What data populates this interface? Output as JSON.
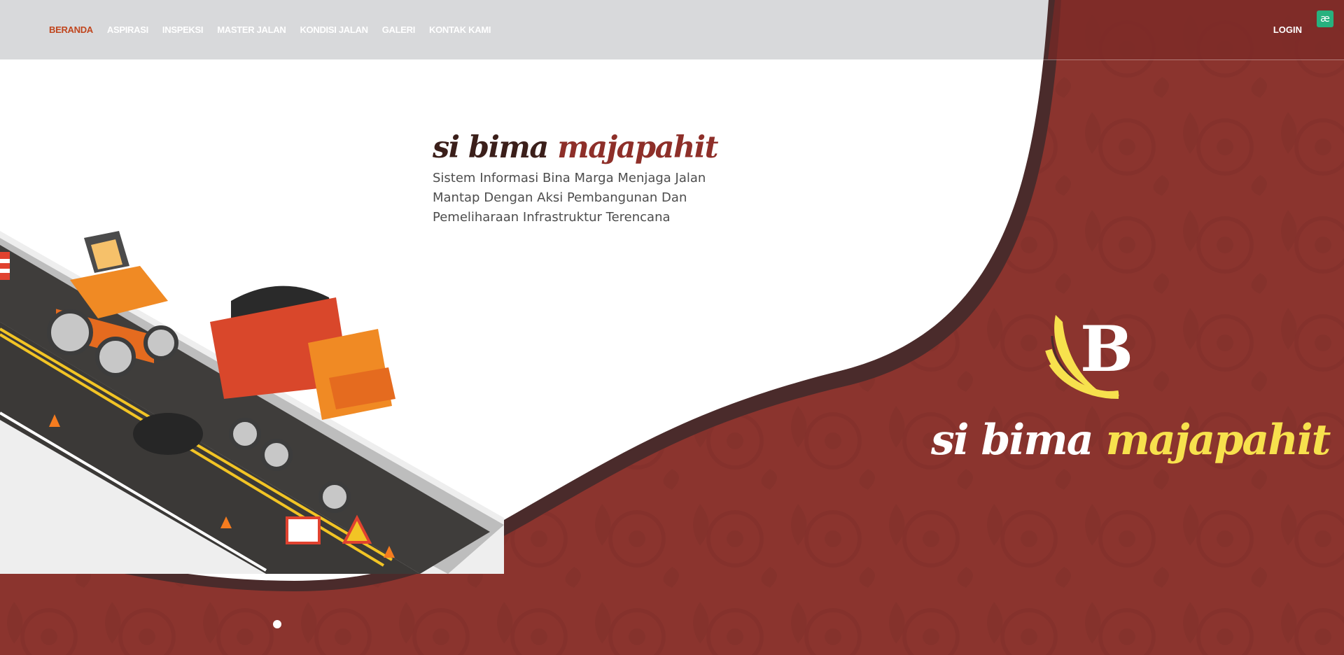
{
  "navbar": {
    "items": [
      {
        "label": "BERANDA",
        "active": true
      },
      {
        "label": "ASPIRASI",
        "active": false
      },
      {
        "label": "INSPEKSI",
        "active": false
      },
      {
        "label": "MASTER JALAN",
        "active": false
      },
      {
        "label": "KONDISI JALAN",
        "active": false
      },
      {
        "label": "GALERI",
        "active": false
      },
      {
        "label": "KONTAK KAMI",
        "active": false
      }
    ],
    "login_label": "LOGIN",
    "active_color": "#c0461e"
  },
  "hero": {
    "title_part1": "si bima",
    "title_part2": "majapahit",
    "tagline": "Sistem Informasi Bina Marga Menjaga Jalan Mantap Dengan Aksi Pembangunan Dan Pemeliharaan Infrastruktur Terencana"
  },
  "logo": {
    "icon": "bima-feather-b-logo",
    "wordmark_part1": "si bima",
    "wordmark_part2": "majapahit"
  },
  "carousel": {
    "slides": 1,
    "current": 1
  },
  "colors": {
    "maroon": "#8b342e",
    "dark_border": "#4a2b2b",
    "nav_gray": "#d8d9db",
    "logo_yellow": "#f7e14d",
    "extension_badge": "#27b17e"
  },
  "extension_icon": "ae-extension-icon"
}
